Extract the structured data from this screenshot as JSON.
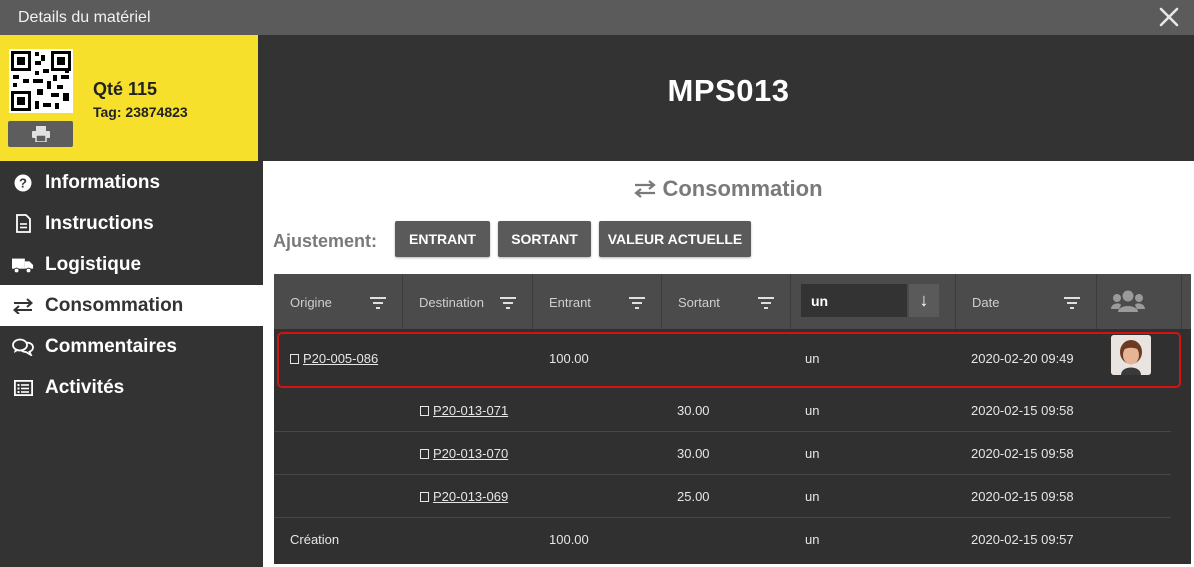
{
  "window": {
    "title": "Details du matériel",
    "close_icon": "close-icon"
  },
  "tag_card": {
    "qty": "Qté 115",
    "tag": "Tag: 23874823",
    "print_icon": "printer-icon",
    "background": "#f7e02c"
  },
  "header": {
    "title": "MPS013"
  },
  "nav": {
    "items": [
      {
        "label": "Informations",
        "icon": "question-circle-icon"
      },
      {
        "label": "Instructions",
        "icon": "document-icon"
      },
      {
        "label": "Logistique",
        "icon": "truck-icon"
      },
      {
        "label": "Consommation",
        "icon": "swap-arrows-icon",
        "active": true
      },
      {
        "label": "Commentaires",
        "icon": "comments-icon"
      },
      {
        "label": "Activités",
        "icon": "list-icon"
      }
    ]
  },
  "section": {
    "title": "Consommation",
    "icon": "swap-arrows-icon"
  },
  "adjust": {
    "label": "Ajustement:",
    "buttons": [
      "ENTRANT",
      "SORTANT",
      "VALEUR ACTUELLE"
    ]
  },
  "table": {
    "columns": [
      "Origine",
      "Destination",
      "Entrant",
      "Sortant",
      "Date"
    ],
    "unit_filter_value": "un",
    "sort_icon": "arrow-down-icon",
    "users_icon": "users-icon",
    "rows": [
      {
        "origin": "P20-005-086",
        "destination": "",
        "in": "100.00",
        "out": "",
        "unit": "un",
        "date": "2020-02-20 09:49",
        "has_avatar": true
      },
      {
        "origin": "",
        "destination": "P20-013-071",
        "in": "",
        "out": "30.00",
        "unit": "un",
        "date": "2020-02-15 09:58"
      },
      {
        "origin": "",
        "destination": "P20-013-070",
        "in": "",
        "out": "30.00",
        "unit": "un",
        "date": "2020-02-15 09:58"
      },
      {
        "origin": "",
        "destination": "P20-013-069",
        "in": "",
        "out": "25.00",
        "unit": "un",
        "date": "2020-02-15 09:58"
      },
      {
        "origin": "Création",
        "destination": "",
        "in": "100.00",
        "out": "",
        "unit": "un",
        "date": "2020-02-15 09:57"
      }
    ]
  },
  "colors": {
    "dark": "#333333",
    "accent_yellow": "#f7e02c",
    "highlight": "#d01414"
  }
}
